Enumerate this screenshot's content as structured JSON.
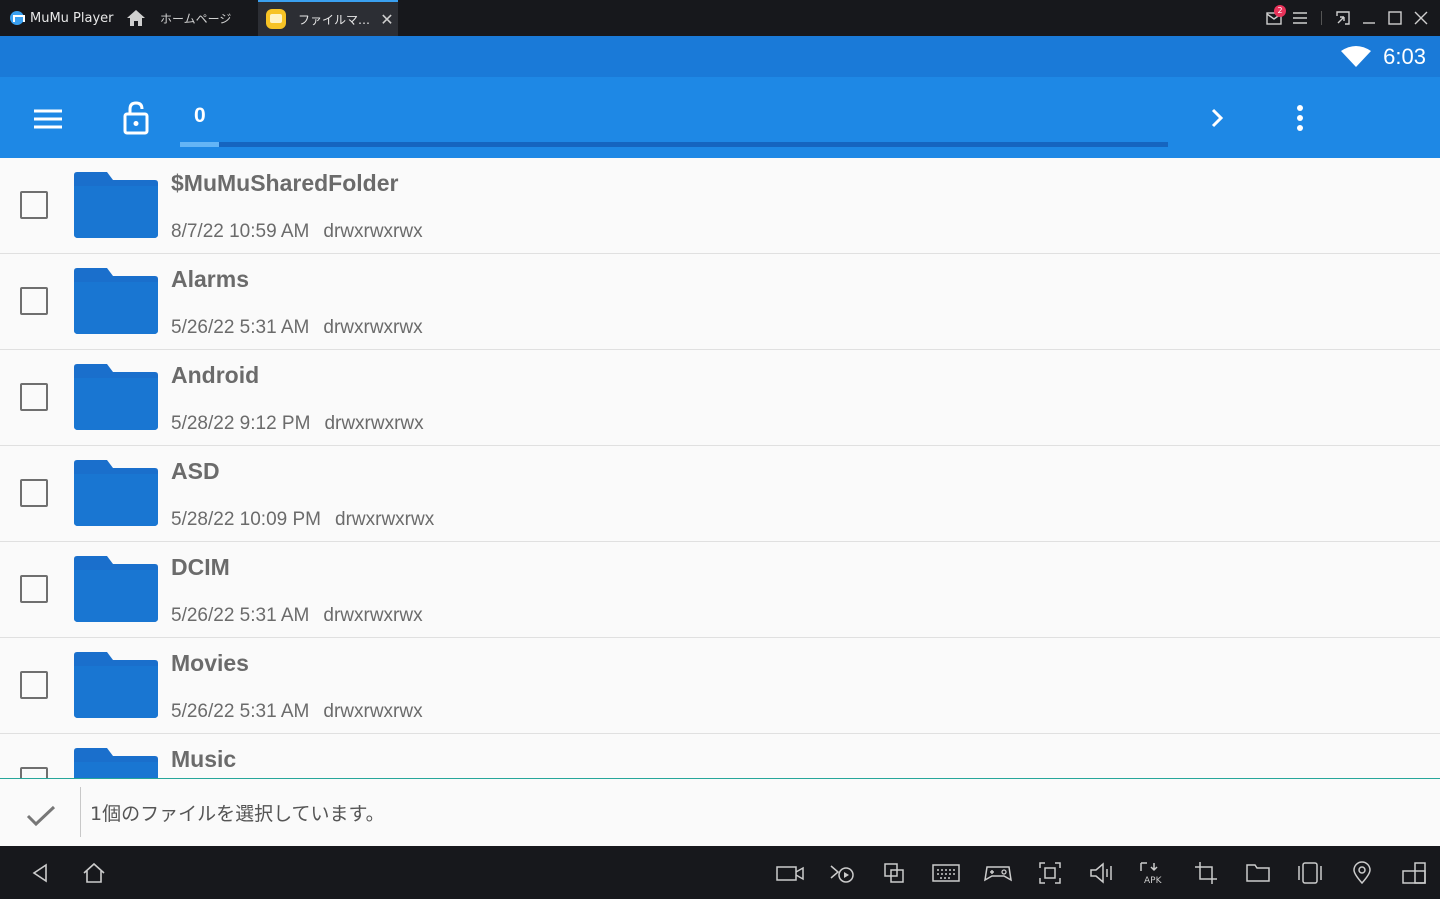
{
  "titlebar": {
    "app_name": "MuMu Player",
    "home_label": "ホームページ",
    "tab_title": "ファイルマ…",
    "tab_close": "✕",
    "mail_badge": "2"
  },
  "status": {
    "time": "6:03"
  },
  "appbar": {
    "path_label": "0"
  },
  "files": [
    {
      "name": "$MuMuSharedFolder",
      "date": "8/7/22 10:59 AM",
      "perm": "drwxrwxrwx"
    },
    {
      "name": "Alarms",
      "date": "5/26/22 5:31 AM",
      "perm": "drwxrwxrwx"
    },
    {
      "name": "Android",
      "date": "5/28/22 9:12 PM",
      "perm": "drwxrwxrwx"
    },
    {
      "name": "ASD",
      "date": "5/28/22 10:09 PM",
      "perm": "drwxrwxrwx"
    },
    {
      "name": "DCIM",
      "date": "5/26/22 5:31 AM",
      "perm": "drwxrwxrwx"
    },
    {
      "name": "Movies",
      "date": "5/26/22 5:31 AM",
      "perm": "drwxrwxrwx"
    },
    {
      "name": "Music",
      "date": "",
      "perm": ""
    }
  ],
  "selection": {
    "text": "1個のファイルを選択しています。"
  },
  "colors": {
    "status_bar": "#1a7ad8",
    "app_bar": "#1e88e5",
    "folder": "#1976d2",
    "selection_border": "#26a69a"
  }
}
